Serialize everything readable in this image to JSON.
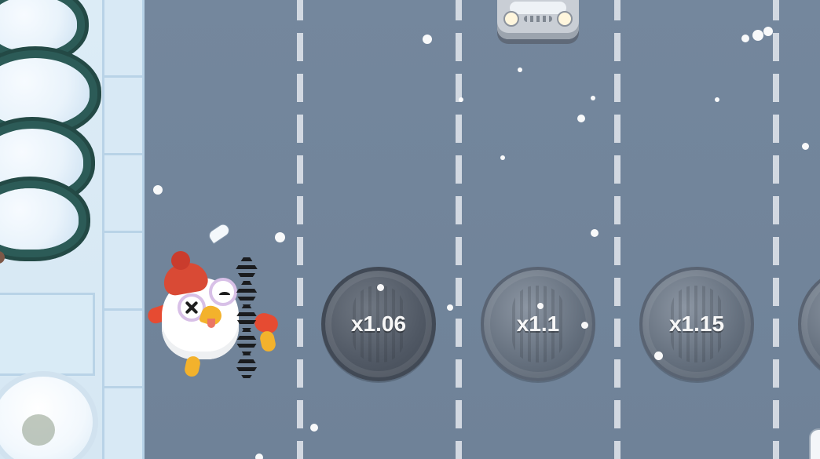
{
  "game": {
    "scene": "snowy-crossing-road",
    "multipliers": [
      "x1.06",
      "x1.1",
      "x1.15"
    ],
    "active_multiplier": "x1.06",
    "character": {
      "name": "chicken",
      "state": "hit"
    },
    "vehicle": {
      "type": "car",
      "visible": true
    }
  },
  "colors": {
    "road": "#71849b",
    "lane_marking": "#d7dde5",
    "sidewalk": "#dcecf6",
    "manhole": "#646f7d",
    "manhole_active": "#505864",
    "text": "#f7f7f7",
    "chicken_hat": "#d94a35",
    "chicken_accent": "#e64b32"
  },
  "icons": {
    "character_icon": "chicken-icon",
    "vehicle_icon": "car-icon",
    "tire_track_icon": "tire-track-icon",
    "feather_icon": "feather-icon",
    "tree_icon": "pine-tree-icon",
    "snowflake_icon": "snowflake-icon"
  }
}
